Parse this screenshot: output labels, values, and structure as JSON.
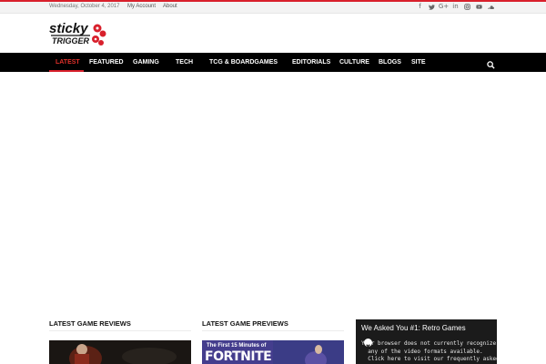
{
  "topbar": {
    "date": "Wednesday, October 4, 2017",
    "links": [
      "My Account",
      "About"
    ]
  },
  "social_icons": [
    "facebook-icon",
    "twitter-icon",
    "google-plus-icon",
    "linkedin-icon",
    "instagram-icon",
    "youtube-icon",
    "soundcloud-icon"
  ],
  "logo": {
    "text_top": "sticky",
    "text_bottom": "TRIGGER"
  },
  "nav": {
    "items": [
      "LATEST",
      "FEATURED",
      "GAMING",
      "TECH",
      "TCG & BOARDGAMES",
      "EDITORIALS",
      "CULTURE",
      "BLOGS",
      "SITE"
    ],
    "active": "LATEST"
  },
  "sections": {
    "reviews_title": "LATEST GAME REVIEWS",
    "previews_title": "LATEST GAME PREVIEWS"
  },
  "preview_thumb": {
    "caption": "The First 15 Minutes of",
    "big_text": "FORTNITE"
  },
  "video_widget": {
    "title": "We Asked You #1: Retro Games",
    "message": "Your browser does not currently recognize\n  any of the video formats available.\n  Click here to visit our frequently asked"
  },
  "colors": {
    "accent": "#d8202c",
    "nav_bg": "#000000",
    "topbar_bg": "#f3f3f3"
  }
}
